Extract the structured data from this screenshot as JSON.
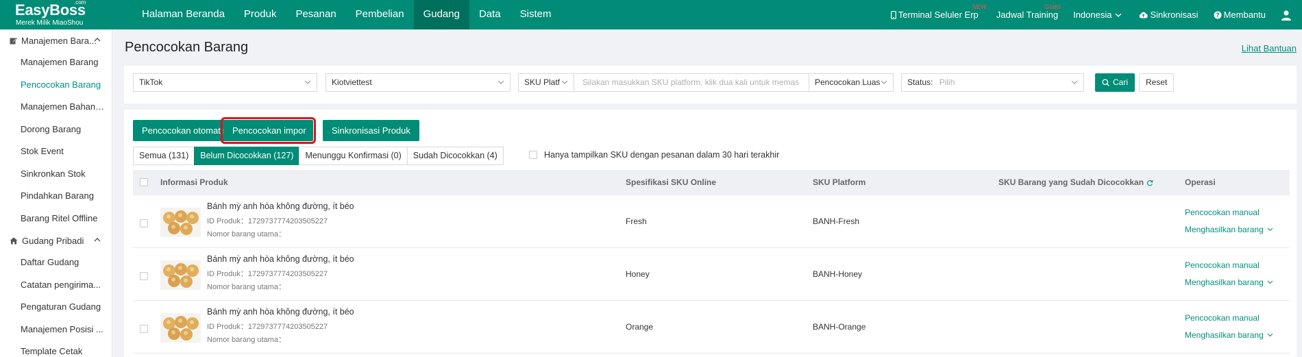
{
  "app": {
    "brand": "EasyBoss",
    "brand_suffix": ".com",
    "tagline": "Merek Milik MiaoShou"
  },
  "top_nav": {
    "items": [
      {
        "label": "Halaman Beranda"
      },
      {
        "label": "Produk"
      },
      {
        "label": "Pesanan"
      },
      {
        "label": "Pembelian"
      },
      {
        "label": "Gudang",
        "active": true
      },
      {
        "label": "Data"
      },
      {
        "label": "Sistem"
      }
    ],
    "right": {
      "terminal": "Terminal Seluler Erp",
      "terminal_badge": "NEW",
      "training": "Jadwal Training",
      "training_badge": "Gratis",
      "language": "Indonesia",
      "sync": "Sinkronisasi",
      "help": "Membantu"
    }
  },
  "sidebar": {
    "group1": "Manajemen Bara...",
    "group1_items": [
      {
        "label": "Manajemen Barang"
      },
      {
        "label": "Pencocokan Barang",
        "active": true
      },
      {
        "label": "Manajemen Bahan ..."
      },
      {
        "label": "Dorong Barang"
      },
      {
        "label": "Stok Event"
      },
      {
        "label": "Sinkronkan Stok"
      },
      {
        "label": "Pindahkan Barang"
      },
      {
        "label": "Barang Ritel Offline"
      }
    ],
    "group2": "Gudang Pribadi",
    "group2_items": [
      {
        "label": "Daftar Gudang"
      },
      {
        "label": "Catatan pengirima..."
      },
      {
        "label": "Pengaturan Gudang"
      },
      {
        "label": "Manajemen Posisi ..."
      },
      {
        "label": "Template Cetak"
      }
    ]
  },
  "page": {
    "title": "Pencocokan Barang",
    "help_link": "Lihat Bantuan"
  },
  "filters": {
    "platform": "TikTok",
    "store": "Kiotviettest",
    "sku_type": "SKU Platf",
    "sku_placeholder": "Silakan masukkan SKU platform, klik dua kali untuk memas",
    "match_mode": "Pencocokan Luas",
    "status_label": "Status:",
    "status_placeholder": "Pilih",
    "search_button": "Cari",
    "reset_button": "Reset"
  },
  "actions": {
    "auto_match": "Pencocokan otomatis",
    "import_match": "Pencocokan impor",
    "sync_product": "Sinkronisasi Produk"
  },
  "tabs": [
    {
      "label": "Semua (131)"
    },
    {
      "label": "Belum Dicocokkan (127)",
      "active": true
    },
    {
      "label": "Menunggu Konfirmasi (0)"
    },
    {
      "label": "Sudah Dicocokkan (4)"
    }
  ],
  "only_30_days": "Hanya tampilkan SKU dengan pesanan dalam 30 hari terakhir",
  "table": {
    "headers": {
      "product_info": "Informasi Produk",
      "online_sku_spec": "Spesifikasi SKU Online",
      "platform_sku": "SKU Platform",
      "matched_sku": "SKU Barang yang Sudah Dicocokkan",
      "operation": "Operasi"
    },
    "rows": [
      {
        "name": "Bánh mỳ anh hòa không đường, ít béo",
        "product_id": "ID Produk：1729737774203505227",
        "main_no": "Nomor barang utama：",
        "spec": "Fresh",
        "platform_sku": "BANH-Fresh",
        "op_manual": "Pencocokan manual",
        "op_generate": "Menghasilkan barang"
      },
      {
        "name": "Bánh mỳ anh hòa không đường, ít béo",
        "product_id": "ID Produk：1729737774203505227",
        "main_no": "Nomor barang utama：",
        "spec": "Honey",
        "platform_sku": "BANH-Honey",
        "op_manual": "Pencocokan manual",
        "op_generate": "Menghasilkan barang"
      },
      {
        "name": "Bánh mỳ anh hòa không đường, ít béo",
        "product_id": "ID Produk：1729737774203505227",
        "main_no": "Nomor barang utama：",
        "spec": "Orange",
        "platform_sku": "BANH-Orange",
        "op_manual": "Pencocokan manual",
        "op_generate": "Menghasilkan barang"
      }
    ]
  },
  "colors": {
    "primary": "#008c76",
    "nav_active": "#00705e",
    "link": "#00907b",
    "highlight_box": "#e0121b",
    "badge": "#ff4d4f"
  }
}
